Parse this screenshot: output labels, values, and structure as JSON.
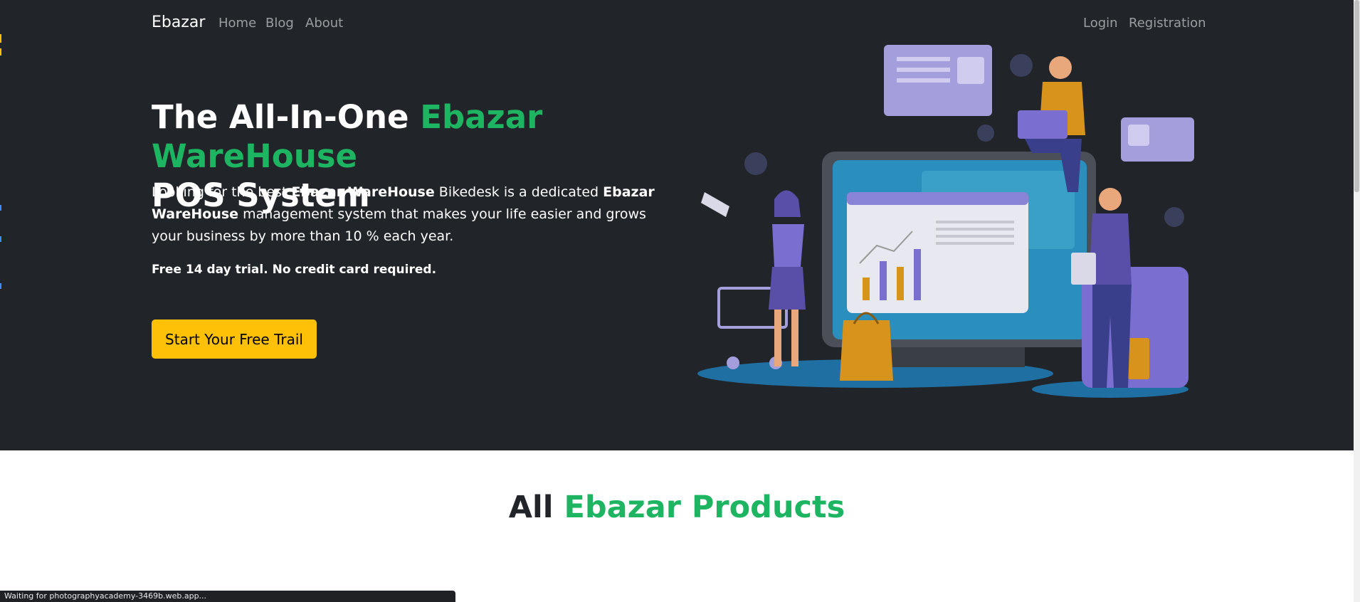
{
  "nav": {
    "brand": "Ebazar",
    "links": [
      "Home",
      "Blog",
      "About"
    ],
    "auth": [
      "Login",
      "Registration"
    ]
  },
  "hero": {
    "title_part1": "The All-In-One ",
    "title_accent": "Ebazar WareHouse",
    "title_part2": "POS System",
    "desc_part1": "Looking for the best ",
    "desc_bold1": "Ebazar WareHouse",
    "desc_part2": " Bikedesk is a dedicated ",
    "desc_bold2": "Ebazar WareHouse",
    "desc_part3": " management system that makes your life easier and grows your business by more than 10 % each year.",
    "note": "Free 14 day trial. No credit card required.",
    "cta_label": "Start Your Free Trail"
  },
  "products": {
    "title_part1": "All ",
    "title_accent": "Ebazar Products"
  },
  "status_bar": {
    "text": "Waiting for photographyacademy-3469b.web.app..."
  },
  "colors": {
    "hero_bg": "#212529",
    "accent_green": "#1db561",
    "cta_yellow": "#ffc107"
  },
  "icons": [
    "illustration-warehouse-pos"
  ]
}
